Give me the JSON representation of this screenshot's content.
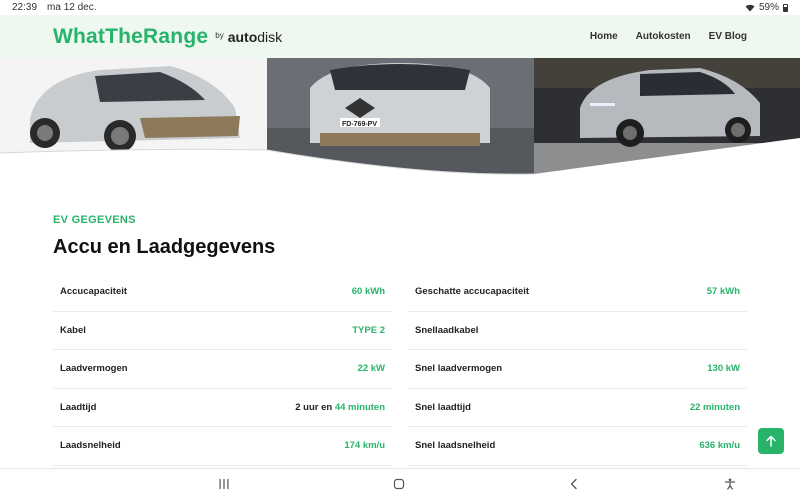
{
  "status": {
    "time": "22:39",
    "date": "ma 12 dec.",
    "battery": "59%"
  },
  "header": {
    "logo": "WhatTheRange",
    "logo_by": "by",
    "logo_auto": "auto",
    "logo_disk": "disk",
    "nav": [
      "Home",
      "Autokosten",
      "EV Blog"
    ]
  },
  "hero": {
    "plate": "FD-769-PV"
  },
  "section": {
    "eyebrow": "EV GEGEVENS",
    "title": "Accu en Laadgegevens"
  },
  "specs": {
    "left": [
      {
        "label": "Accucapaciteit",
        "value": "60 kWh"
      },
      {
        "label": "Kabel",
        "value": "TYPE 2"
      },
      {
        "label": "Laadvermogen",
        "value": "22 kW"
      },
      {
        "label": "Laadtijd",
        "value_prefix": "2 uur en ",
        "value": "44 minuten"
      },
      {
        "label": "Laadsnelheid",
        "value": "174 km/u"
      }
    ],
    "right": [
      {
        "label": "Geschatte accucapaciteit",
        "value": "57 kWh"
      },
      {
        "label": "Snellaadkabel",
        "value": ""
      },
      {
        "label": "Snel laadvermogen",
        "value": "130 kW"
      },
      {
        "label": "Snel laadtijd",
        "value": "22 minuten"
      },
      {
        "label": "Snel laadsnelheid",
        "value": "636 km/u"
      }
    ]
  },
  "colors": {
    "accent": "#27b46a",
    "header_bg": "#eef7f0"
  },
  "icons": {
    "scroll_top": "arrow-up-icon",
    "recent": "recent-apps-icon",
    "home": "home-icon",
    "back": "back-icon",
    "accessibility": "accessibility-icon"
  }
}
